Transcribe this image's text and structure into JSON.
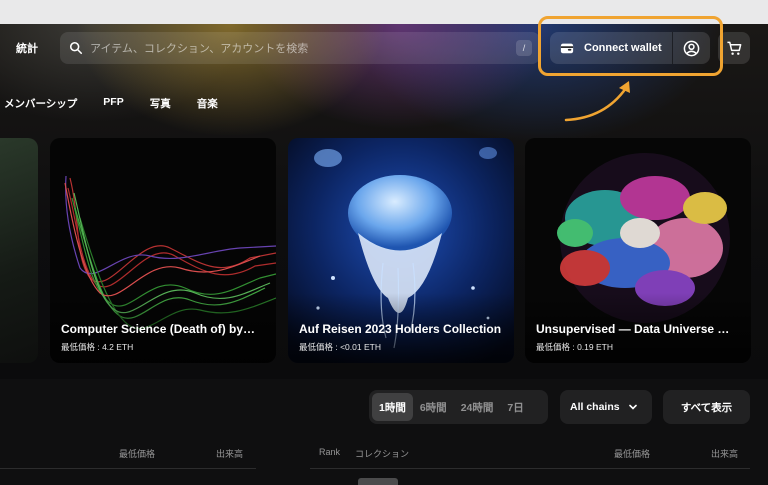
{
  "nav": {
    "stats_label": "統計",
    "search_placeholder": "アイテム、コレクション、アカウントを検索",
    "search_shortcut": "/",
    "connect_wallet_label": "Connect wallet"
  },
  "categories": [
    "メンバーシップ",
    "PFP",
    "写真",
    "音楽"
  ],
  "featured": [
    {
      "title": "Computer Science (Death of) by…",
      "price": "最低価格 : 4.2 ETH"
    },
    {
      "title": "Auf Reisen 2023 Holders Collection",
      "price": "最低価格 : <0.01 ETH"
    },
    {
      "title": "Unsupervised — Data Universe —…",
      "price": "最低価格 : 0.19 ETH"
    }
  ],
  "controls": {
    "time_ranges": [
      "1時間",
      "6時間",
      "24時間",
      "7日"
    ],
    "active_range": "1時間",
    "chains_label": "All chains",
    "view_all_label": "すべて表示"
  },
  "table_left": {
    "floor_price": "最低価格",
    "volume": "出来高"
  },
  "table_right": {
    "rank": "Rank",
    "collection": "コレクション",
    "floor_price": "最低価格",
    "volume": "出来高"
  },
  "colors": {
    "highlight": "#f0a431"
  }
}
